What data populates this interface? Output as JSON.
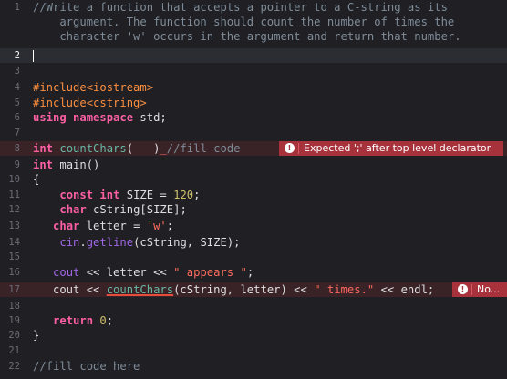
{
  "editor": {
    "lines": [
      {
        "n": "1",
        "parts": [
          {
            "t": "//Write a function that accepts a pointer to a C-string as its",
            "c": "cmt"
          }
        ]
      },
      {
        "n": "",
        "parts": [
          {
            "t": "    argument. The function should count the number of times the",
            "c": "cmt"
          }
        ]
      },
      {
        "n": "",
        "parts": [
          {
            "t": "    character 'w' occurs in the argument and return that number.",
            "c": "cmt"
          }
        ]
      },
      {
        "n": "2",
        "current": true,
        "parts": [
          {
            "t": "",
            "c": ""
          }
        ],
        "caret": true
      },
      {
        "n": "3",
        "parts": []
      },
      {
        "n": "4",
        "parts": [
          {
            "t": "#include<iostream>",
            "c": "pp"
          }
        ]
      },
      {
        "n": "5",
        "parts": [
          {
            "t": "#include<cstring>",
            "c": "pp"
          }
        ]
      },
      {
        "n": "6",
        "parts": [
          {
            "t": "using",
            "c": "kw"
          },
          {
            "t": " "
          },
          {
            "t": "namespace",
            "c": "kw"
          },
          {
            "t": " std;"
          }
        ]
      },
      {
        "n": "7",
        "parts": []
      },
      {
        "n": "8",
        "error": true,
        "parts": [
          {
            "t": "int",
            "c": "kw"
          },
          {
            "t": " "
          },
          {
            "t": "countChars",
            "c": "fn"
          },
          {
            "t": "(   )"
          },
          {
            "t": "_",
            "c": "str"
          },
          {
            "t": "//fill code",
            "c": "cmt"
          }
        ]
      },
      {
        "n": "9",
        "parts": [
          {
            "t": "int",
            "c": "kw"
          },
          {
            "t": " main()"
          }
        ]
      },
      {
        "n": "10",
        "parts": [
          {
            "t": "{"
          }
        ]
      },
      {
        "n": "11",
        "parts": [
          {
            "t": "    "
          },
          {
            "t": "const",
            "c": "kw"
          },
          {
            "t": " "
          },
          {
            "t": "int",
            "c": "kw"
          },
          {
            "t": " SIZE = "
          },
          {
            "t": "120",
            "c": "num"
          },
          {
            "t": ";"
          }
        ]
      },
      {
        "n": "12",
        "parts": [
          {
            "t": "    "
          },
          {
            "t": "char",
            "c": "kw"
          },
          {
            "t": " cString[SIZE];"
          }
        ]
      },
      {
        "n": "13",
        "parts": [
          {
            "t": "   "
          },
          {
            "t": "char",
            "c": "kw"
          },
          {
            "t": " letter = "
          },
          {
            "t": "'w'",
            "c": "str"
          },
          {
            "t": ";"
          }
        ]
      },
      {
        "n": "14",
        "parts": [
          {
            "t": "    "
          },
          {
            "t": "cin",
            "c": "lib"
          },
          {
            "t": "."
          },
          {
            "t": "getline",
            "c": "lib"
          },
          {
            "t": "(cString, SIZE);"
          }
        ]
      },
      {
        "n": "15",
        "parts": []
      },
      {
        "n": "16",
        "parts": [
          {
            "t": "   "
          },
          {
            "t": "cout",
            "c": "lib"
          },
          {
            "t": " << letter << "
          },
          {
            "t": "\" appears \"",
            "c": "str"
          },
          {
            "t": ";"
          }
        ]
      },
      {
        "n": "17",
        "error": true,
        "parts": [
          {
            "t": "   cout << "
          },
          {
            "t": "countChars",
            "c": "fn ul"
          },
          {
            "t": "(cString, letter) << "
          },
          {
            "t": "\" times.\"",
            "c": "str"
          },
          {
            "t": " << endl;"
          }
        ]
      },
      {
        "n": "18",
        "parts": []
      },
      {
        "n": "19",
        "parts": [
          {
            "t": "   "
          },
          {
            "t": "return",
            "c": "kw"
          },
          {
            "t": " "
          },
          {
            "t": "0",
            "c": "num"
          },
          {
            "t": ";"
          }
        ]
      },
      {
        "n": "20",
        "parts": [
          {
            "t": "}"
          }
        ]
      },
      {
        "n": "21",
        "parts": []
      },
      {
        "n": "22",
        "parts": [
          {
            "t": "//fill code here",
            "c": "cmt"
          }
        ]
      }
    ]
  },
  "errors": [
    {
      "line_index": 9,
      "message": "Expected ';' after top level declarator",
      "icon": "error-icon",
      "icon_glyph": "!"
    },
    {
      "line_index": 18,
      "message": "No...",
      "icon": "error-icon",
      "icon_glyph": "!"
    }
  ],
  "colors": {
    "background": "#1f1f24",
    "comment": "#7f8c98",
    "keyword": "#fc5fa3",
    "preprocessor": "#fd8f3f",
    "string": "#fc6a5d",
    "number": "#d0bf69",
    "error_badge": "#a7323c"
  }
}
